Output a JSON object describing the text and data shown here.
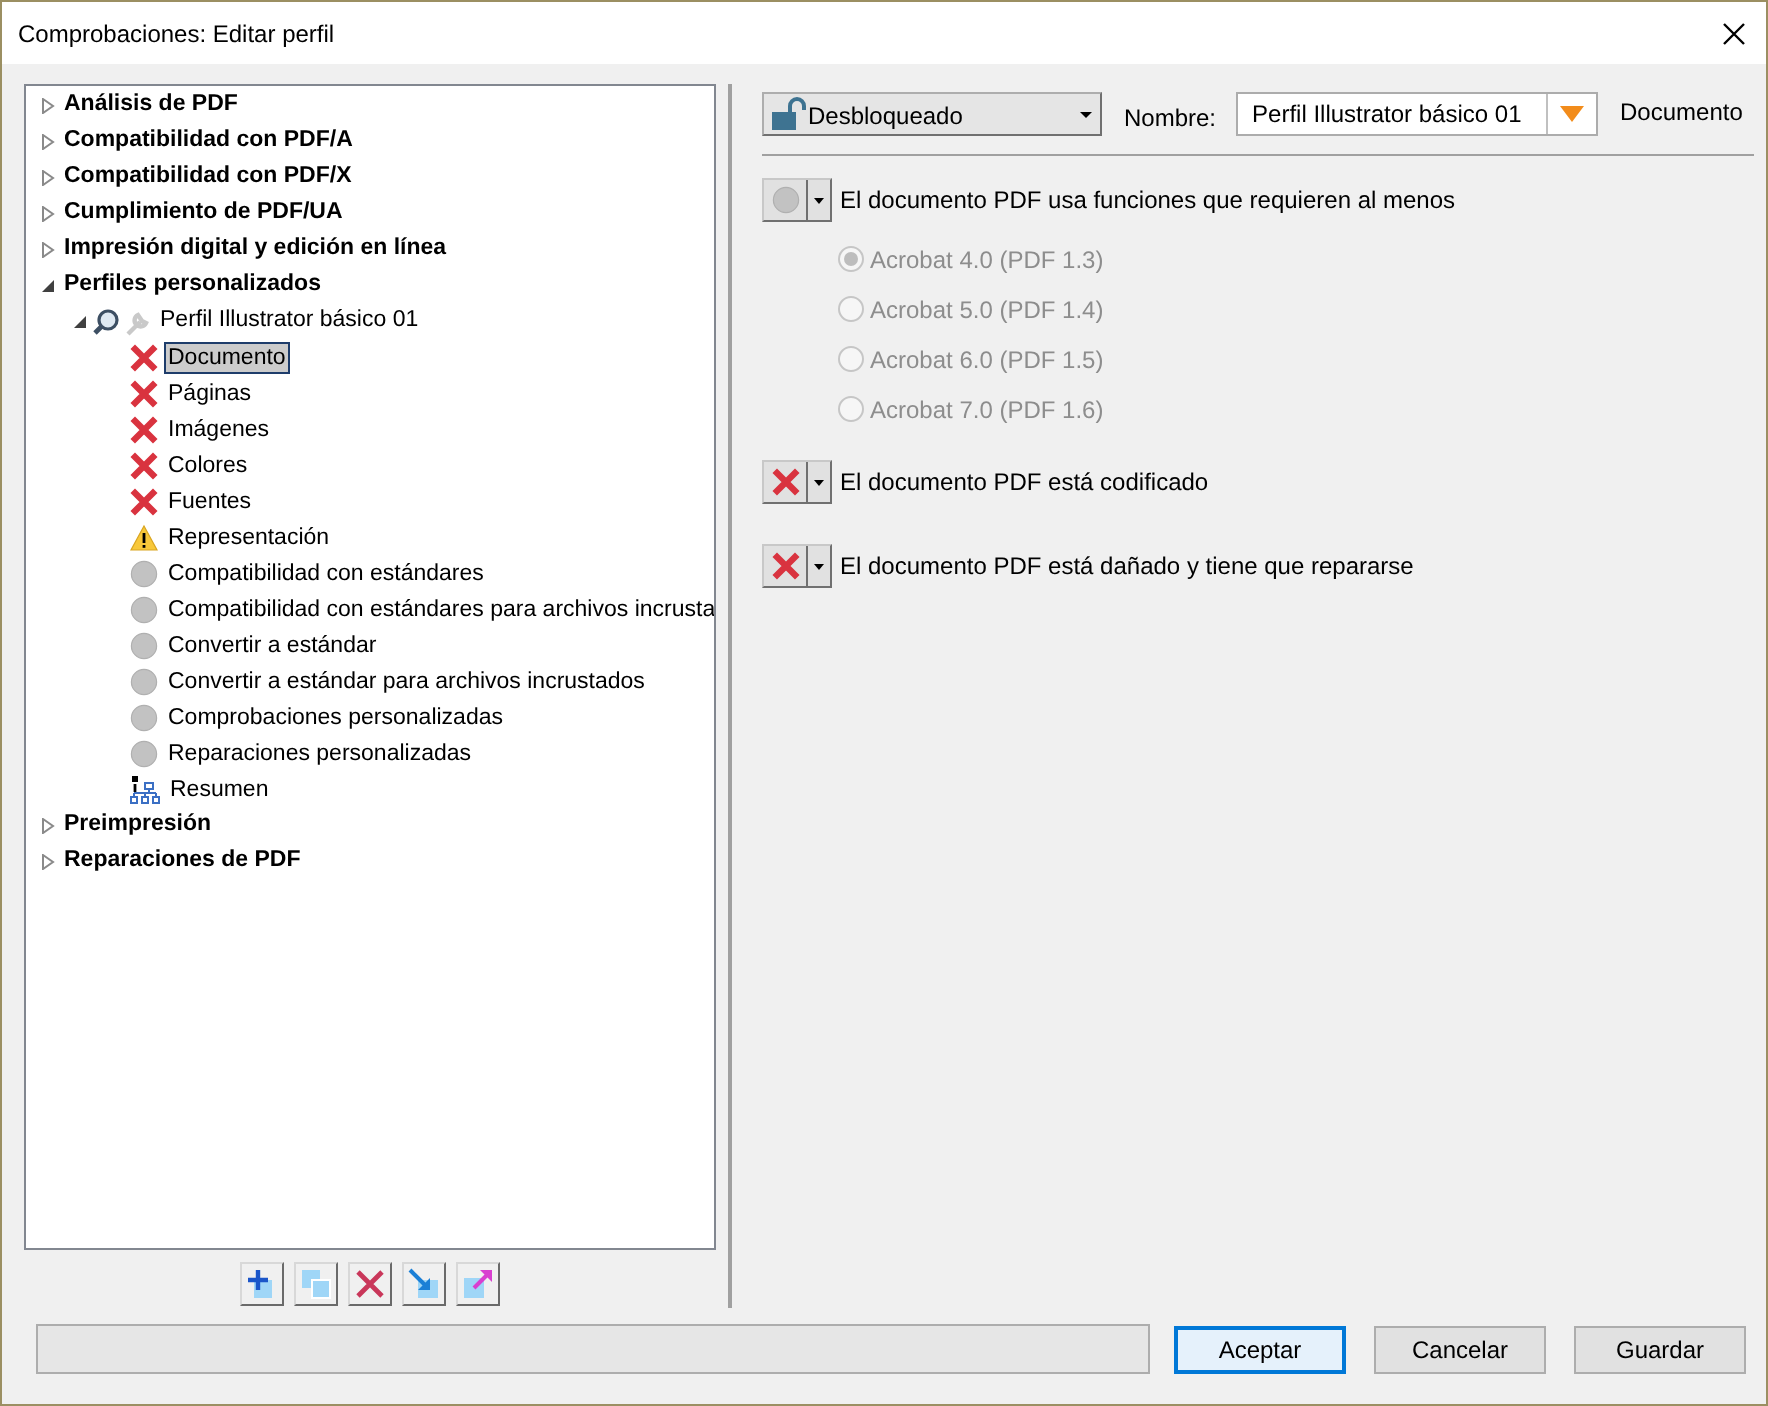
{
  "window": {
    "title": "Comprobaciones: Editar perfil"
  },
  "tree": [
    {
      "label": "Análisis de PDF",
      "expanded": false
    },
    {
      "label": "Compatibilidad con PDF/A",
      "expanded": false
    },
    {
      "label": "Compatibilidad con PDF/X",
      "expanded": false
    },
    {
      "label": "Cumplimiento de PDF/UA",
      "expanded": false
    },
    {
      "label": "Impresión digital y edición en línea",
      "expanded": false
    },
    {
      "label": "Perfiles personalizados",
      "expanded": true,
      "children": [
        {
          "label": "Perfil Illustrator básico 01",
          "expanded": true,
          "children": [
            {
              "label": "Documento",
              "kind": "error",
              "selected": true
            },
            {
              "label": "Páginas",
              "kind": "error",
              "selected": false
            },
            {
              "label": "Imágenes",
              "kind": "error",
              "selected": false
            },
            {
              "label": "Colores",
              "kind": "error",
              "selected": false
            },
            {
              "label": "Fuentes",
              "kind": "error",
              "selected": false
            },
            {
              "label": "Representación",
              "kind": "warning",
              "selected": false
            },
            {
              "label": "Compatibilidad con estándares",
              "kind": "off",
              "selected": false
            },
            {
              "label": "Compatibilidad con estándares para archivos incrusta",
              "kind": "off",
              "selected": false
            },
            {
              "label": "Convertir a estándar",
              "kind": "off",
              "selected": false
            },
            {
              "label": "Convertir a estándar para archivos incrustados",
              "kind": "off",
              "selected": false
            },
            {
              "label": "Comprobaciones personalizadas",
              "kind": "off",
              "selected": false
            },
            {
              "label": "Reparaciones personalizadas",
              "kind": "off",
              "selected": false
            },
            {
              "label": "Resumen",
              "kind": "summary",
              "selected": false
            }
          ]
        }
      ]
    },
    {
      "label": "Preimpresión",
      "expanded": false
    },
    {
      "label": "Reparaciones de PDF",
      "expanded": false
    }
  ],
  "lock_dropdown": {
    "value": "Desbloqueado"
  },
  "name_label": "Nombre:",
  "name_field": {
    "value": "Perfil Illustrator básico 01"
  },
  "section_title": "Documento",
  "checks": [
    {
      "kind": "off",
      "label": "El documento PDF usa funciones que requieren al menos",
      "options": [
        {
          "label": "Acrobat 4.0 (PDF 1.3)",
          "selected": true,
          "disabled": true
        },
        {
          "label": "Acrobat 5.0 (PDF 1.4)",
          "selected": false,
          "disabled": true
        },
        {
          "label": "Acrobat 6.0 (PDF 1.5)",
          "selected": false,
          "disabled": true
        },
        {
          "label": "Acrobat 7.0 (PDF 1.6)",
          "selected": false,
          "disabled": true
        }
      ]
    },
    {
      "kind": "error",
      "label": "El documento PDF está codificado"
    },
    {
      "kind": "error",
      "label": "El documento PDF está dañado y tiene que repararse"
    }
  ],
  "buttons": [
    {
      "label": "Aceptar",
      "default": true
    },
    {
      "label": "Cancelar",
      "default": false
    },
    {
      "label": "Guardar",
      "default": false
    }
  ]
}
